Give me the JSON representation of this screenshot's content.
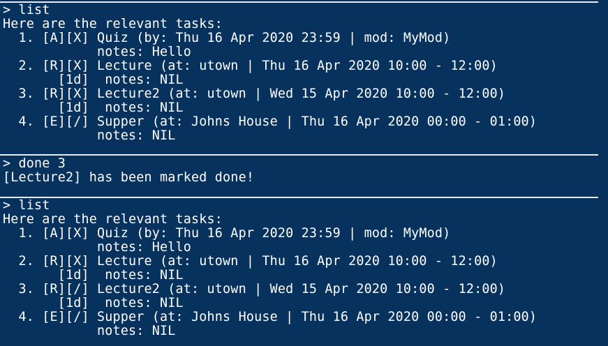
{
  "terminal": {
    "blocks": [
      {
        "lines": [
          "> list",
          "Here are the relevant tasks:",
          "  1. [A][X] Quiz (by: Thu 16 Apr 2020 23:59 | mod: MyMod)",
          "            notes: Hello",
          "  2. [R][X] Lecture (at: utown | Thu 16 Apr 2020 10:00 - 12:00)",
          "       [1d]  notes: NIL",
          "  3. [R][X] Lecture2 (at: utown | Wed 15 Apr 2020 10:00 - 12:00)",
          "       [1d]  notes: NIL",
          "  4. [E][/] Supper (at: Johns House | Thu 16 Apr 2020 00:00 - 01:00)",
          "            notes: NIL"
        ]
      },
      {
        "lines": [
          "> done 3",
          "[Lecture2] has been marked done!"
        ]
      },
      {
        "lines": [
          "> list",
          "Here are the relevant tasks:",
          "  1. [A][X] Quiz (by: Thu 16 Apr 2020 23:59 | mod: MyMod)",
          "            notes: Hello",
          "  2. [R][X] Lecture (at: utown | Thu 16 Apr 2020 10:00 - 12:00)",
          "       [1d]  notes: NIL",
          "  3. [R][/] Lecture2 (at: utown | Wed 15 Apr 2020 10:00 - 12:00)",
          "       [1d]  notes: NIL",
          "  4. [E][/] Supper (at: Johns House | Thu 16 Apr 2020 00:00 - 01:00)",
          "            notes: NIL"
        ]
      }
    ]
  },
  "colors": {
    "background": "#07325e",
    "text": "#ffffff",
    "separator": "#e8eef5"
  }
}
